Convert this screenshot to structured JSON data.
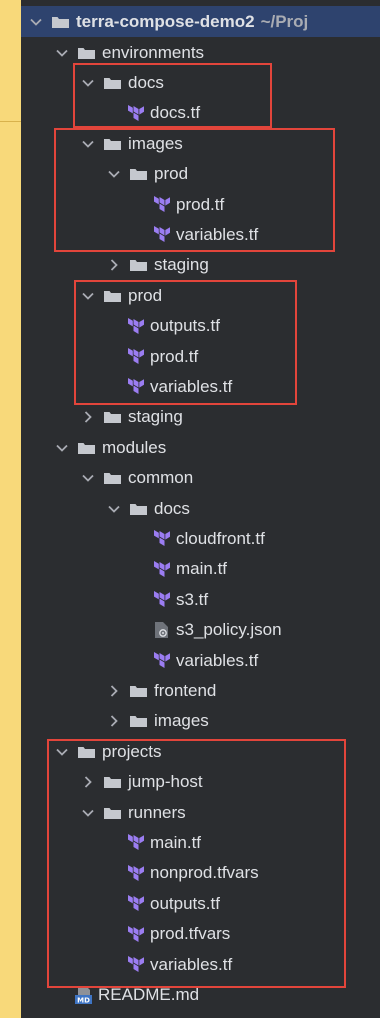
{
  "project_tree": {
    "root": {
      "name": "terra-compose-demo2",
      "path": "~/Proj"
    },
    "items": [
      {
        "label": "environments",
        "type": "folder",
        "expanded": true
      },
      {
        "label": "docs",
        "type": "folder",
        "expanded": true
      },
      {
        "label": "docs.tf",
        "type": "terraform-file"
      },
      {
        "label": "images",
        "type": "folder",
        "expanded": true
      },
      {
        "label": "prod",
        "type": "folder",
        "expanded": true
      },
      {
        "label": "prod.tf",
        "type": "terraform-file"
      },
      {
        "label": "variables.tf",
        "type": "terraform-file"
      },
      {
        "label": "staging",
        "type": "folder",
        "expanded": false
      },
      {
        "label": "prod",
        "type": "folder",
        "expanded": true
      },
      {
        "label": "outputs.tf",
        "type": "terraform-file"
      },
      {
        "label": "prod.tf",
        "type": "terraform-file"
      },
      {
        "label": "variables.tf",
        "type": "terraform-file"
      },
      {
        "label": "staging",
        "type": "folder",
        "expanded": false
      },
      {
        "label": "modules",
        "type": "folder",
        "expanded": true
      },
      {
        "label": "common",
        "type": "folder",
        "expanded": true
      },
      {
        "label": "docs",
        "type": "folder",
        "expanded": true
      },
      {
        "label": "cloudfront.tf",
        "type": "terraform-file"
      },
      {
        "label": "main.tf",
        "type": "terraform-file"
      },
      {
        "label": "s3.tf",
        "type": "terraform-file"
      },
      {
        "label": "s3_policy.json",
        "type": "json-file"
      },
      {
        "label": "variables.tf",
        "type": "terraform-file"
      },
      {
        "label": "frontend",
        "type": "folder",
        "expanded": false
      },
      {
        "label": "images",
        "type": "folder",
        "expanded": false
      },
      {
        "label": "projects",
        "type": "folder",
        "expanded": true
      },
      {
        "label": "jump-host",
        "type": "folder",
        "expanded": false
      },
      {
        "label": "runners",
        "type": "folder",
        "expanded": true
      },
      {
        "label": "main.tf",
        "type": "terraform-file"
      },
      {
        "label": "nonprod.tfvars",
        "type": "terraform-file"
      },
      {
        "label": "outputs.tf",
        "type": "terraform-file"
      },
      {
        "label": "prod.tfvars",
        "type": "terraform-file"
      },
      {
        "label": "variables.tf",
        "type": "terraform-file"
      },
      {
        "label": "README.md",
        "type": "markdown-file"
      }
    ]
  },
  "colors": {
    "background": "#f8d97a",
    "panel": "#2b2d30",
    "selected_row": "#2e436e",
    "highlight_box": "#e2453b",
    "terraform_icon": "#9b7df2",
    "folder_icon": "#c5c8ce"
  }
}
